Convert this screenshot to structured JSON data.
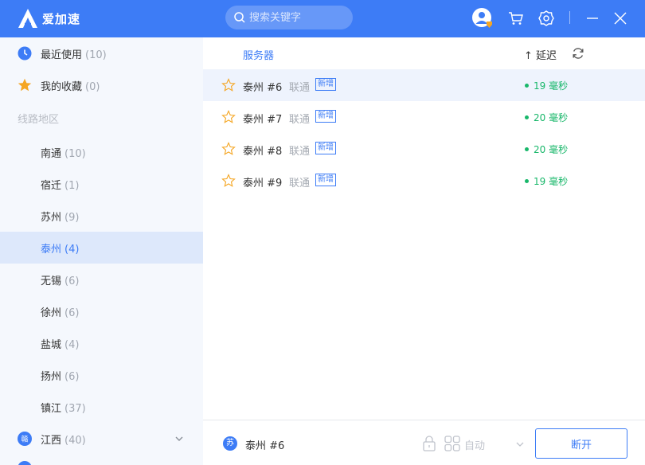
{
  "app": {
    "title": "爱加速"
  },
  "search": {
    "placeholder": "搜索关键字"
  },
  "sidebar": {
    "recent": {
      "label": "最近使用",
      "count": "(10)"
    },
    "favorites": {
      "label": "我的收藏",
      "count": "(0)"
    },
    "section_label": "线路地区",
    "regions": [
      {
        "label": "南通",
        "count": "(10)"
      },
      {
        "label": "宿迁",
        "count": "(1)"
      },
      {
        "label": "苏州",
        "count": "(9)"
      },
      {
        "label": "泰州",
        "count": "(4)",
        "active": true
      },
      {
        "label": "无锡",
        "count": "(6)"
      },
      {
        "label": "徐州",
        "count": "(6)"
      },
      {
        "label": "盐城",
        "count": "(4)"
      },
      {
        "label": "扬州",
        "count": "(6)"
      },
      {
        "label": "镇江",
        "count": "(37)"
      }
    ],
    "province": {
      "label": "江西",
      "count": "(40)",
      "icon_text": "赣"
    }
  },
  "main": {
    "column_server": "服务器",
    "column_latency": "↑ 延迟",
    "servers": [
      {
        "name": "泰州 #6",
        "isp": "联通",
        "badge": "新增",
        "latency": "19 毫秒"
      },
      {
        "name": "泰州 #7",
        "isp": "联通",
        "badge": "新增",
        "latency": "20 毫秒"
      },
      {
        "name": "泰州 #8",
        "isp": "联通",
        "badge": "新增",
        "latency": "20 毫秒"
      },
      {
        "name": "泰州 #9",
        "isp": "联通",
        "badge": "新增",
        "latency": "19 毫秒"
      }
    ]
  },
  "bottom": {
    "current_region_icon": "苏",
    "current_server": "泰州 #6",
    "mode": "自动",
    "disconnect_label": "断开"
  },
  "colors": {
    "brand": "#3d7cf6",
    "latency_good": "#18b76a",
    "favorite": "#f5a623"
  }
}
